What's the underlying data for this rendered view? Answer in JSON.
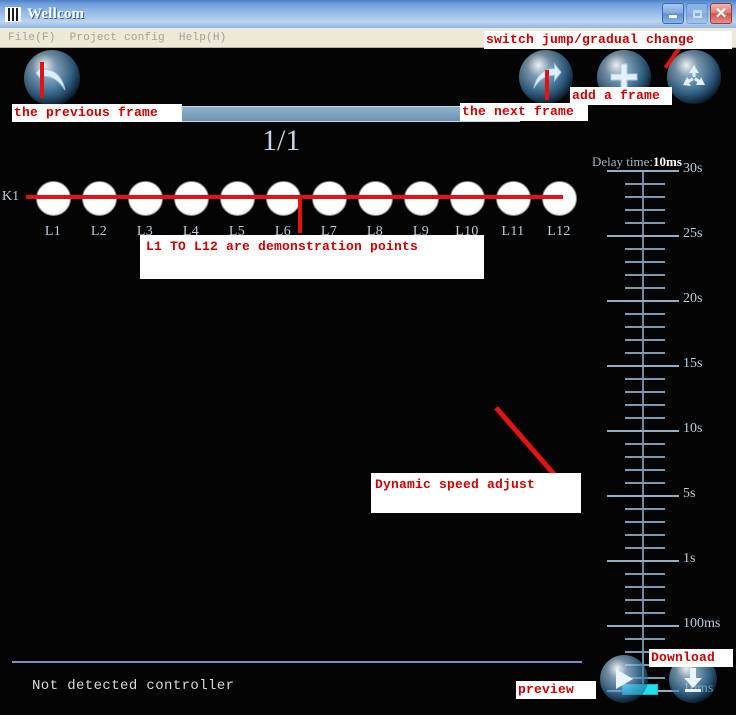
{
  "window": {
    "title": "Wellcom",
    "icon": "barcode-icon",
    "controls": {
      "minimize": "minimize-icon",
      "maximize": "maximize-icon",
      "close": "close-icon"
    }
  },
  "menubar": {
    "items": [
      {
        "label": "File(F)",
        "name": "menu-file"
      },
      {
        "label": "Project config",
        "name": "menu-project-config"
      },
      {
        "label": "Help(H)",
        "name": "menu-help"
      }
    ]
  },
  "toolbar": {
    "previous_frame": "previous-frame-icon",
    "next_frame": "next-frame-icon",
    "add_frame": "add-frame-icon",
    "switch_mode": "recycle-switch-icon",
    "frame_counter": "1/1"
  },
  "lamps": {
    "channel_label": "K1",
    "items": [
      "L1",
      "L2",
      "L3",
      "L4",
      "L5",
      "L6",
      "L7",
      "L8",
      "L9",
      "L10",
      "L11",
      "L12"
    ]
  },
  "delay": {
    "prefix": "Delay time:",
    "value": "10ms",
    "handle_position": "10ms"
  },
  "scale": {
    "major_labels": [
      "30s",
      "25s",
      "20s",
      "15s",
      "10s",
      "5s",
      "1s",
      "100ms",
      "10ms"
    ],
    "minor_ticks_between": 4
  },
  "status": {
    "message": "Not detected controller"
  },
  "actions": {
    "preview": "play-icon",
    "download": "download-icon"
  },
  "annotations": {
    "switch_mode": "switch jump/gradual change",
    "previous_frame": "the previous frame",
    "next_frame": "the next frame",
    "add_frame": "add a frame",
    "lamps": "L1 TO L12 are demonstration points",
    "speed": "Dynamic speed adjust",
    "preview": "preview",
    "download": "Download"
  },
  "colors": {
    "annotation_red": "#cc0000",
    "arrow_red": "#e11414",
    "slider_cyan": "#1fe2ee",
    "canvas_black": "#040404",
    "titlebar_blue": "#75a5dd",
    "menubar_beige": "#ece9d8"
  }
}
